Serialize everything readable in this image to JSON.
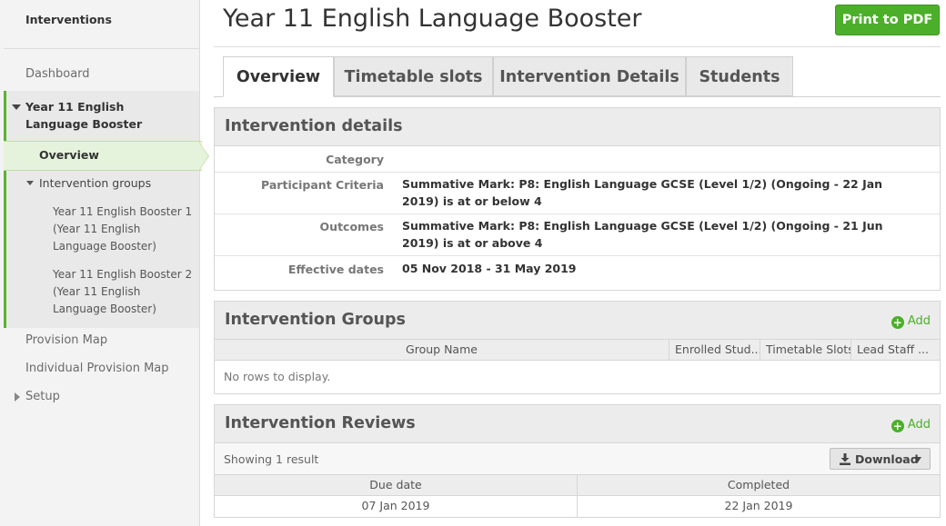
{
  "sidebar": {
    "title": "Interventions",
    "dashboard": "Dashboard",
    "current_intervention": "Year 11 English Language Booster",
    "overview": "Overview",
    "intervention_groups": "Intervention groups",
    "groups": [
      "Year 11 English Booster 1 (Year 11 English Language Booster)",
      "Year 11 English Booster 2 (Year 11 English Language Booster)"
    ],
    "provision_map": "Provision Map",
    "individual_provision_map": "Individual Provision Map",
    "setup": "Setup"
  },
  "header": {
    "title": "Year 11 English Language Booster",
    "print_button": "Print to PDF"
  },
  "tabs": [
    {
      "label": "Overview",
      "active": true
    },
    {
      "label": "Timetable slots",
      "active": false
    },
    {
      "label": "Intervention Details",
      "active": false
    },
    {
      "label": "Students",
      "active": false
    }
  ],
  "details": {
    "heading": "Intervention details",
    "rows": [
      {
        "label": "Category",
        "value": ""
      },
      {
        "label": "Participant Criteria",
        "value": "Summative Mark: P8: English Language GCSE (Level 1/2) (Ongoing - 22 Jan 2019) is at or below 4"
      },
      {
        "label": "Outcomes",
        "value": "Summative Mark: P8: English Language GCSE (Level 1/2) (Ongoing - 21 Jun 2019) is at or above 4"
      },
      {
        "label": "Effective dates",
        "value": "05 Nov 2018 - 31 May 2019"
      }
    ]
  },
  "groups_panel": {
    "heading": "Intervention Groups",
    "add_label": "Add",
    "columns": [
      "Group Name",
      "Enrolled Stud...",
      "Timetable Slots",
      "Lead Staff ..."
    ],
    "empty_text": "No rows to display."
  },
  "reviews_panel": {
    "heading": "Intervention Reviews",
    "add_label": "Add",
    "showing_text": "Showing 1 result",
    "download_label": "Download",
    "columns": [
      "Due date",
      "Completed"
    ],
    "rows": [
      {
        "due": "07 Jan 2019",
        "completed": "22 Jan 2019"
      }
    ]
  },
  "colors": {
    "accent_green": "#4caf2a",
    "sidebar_bg": "#f3f3f3",
    "panel_head_bg": "#ececec"
  }
}
